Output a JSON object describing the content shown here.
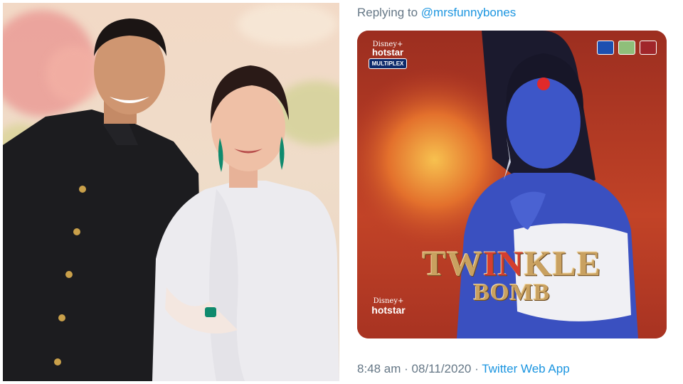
{
  "tweet": {
    "replying_prefix": "Replying to",
    "replying_handle": "@mrsfunnybones",
    "time": "8:48 am",
    "separator": " · ",
    "date": "08/11/2020",
    "source_app": "Twitter Web App"
  },
  "poster": {
    "title_part1": "TW",
    "title_part2": "IN",
    "title_part3": "KLE",
    "subtitle": "BOMB",
    "brand_top_line1": "Disney+",
    "brand_top_line2": "hotstar",
    "brand_top_badge": "MULTIPLEX",
    "brand_bottom_line1": "Disney+",
    "brand_bottom_line2": "hotstar"
  },
  "colors": {
    "link": "#1b95e0",
    "muted": "#657786",
    "poster_red": "#b73a26",
    "title_gold": "#c9a160",
    "figure_blue": "#3d56c8"
  }
}
